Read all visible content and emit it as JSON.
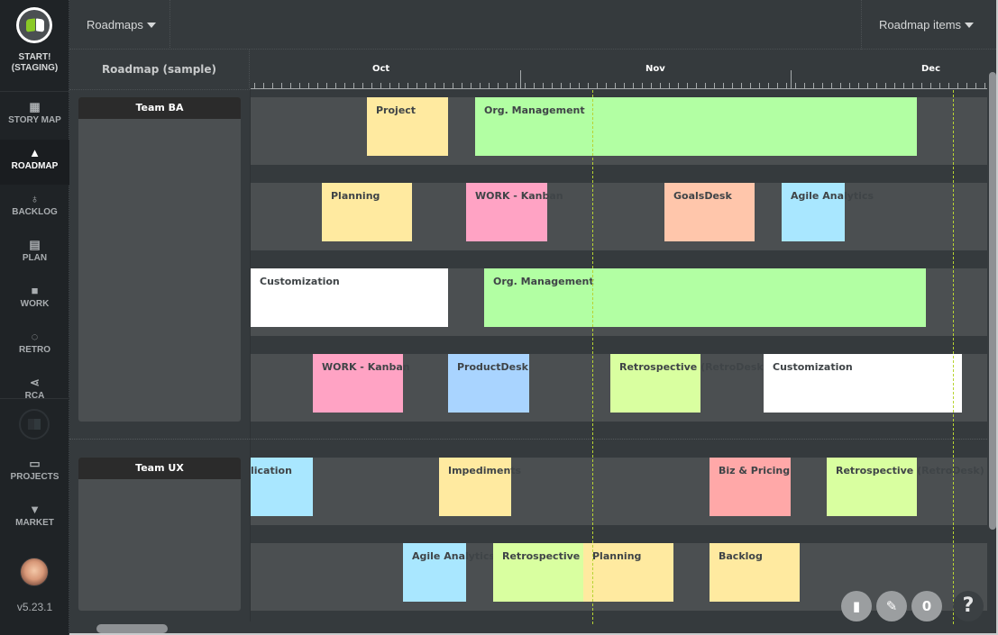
{
  "workspace": {
    "name_line1": "START!",
    "name_line2": "(STAGING)"
  },
  "nav": {
    "items": [
      {
        "label": "STORY MAP",
        "icon": "grid-icon"
      },
      {
        "label": "ROADMAP",
        "icon": "road-icon",
        "active": true
      },
      {
        "label": "BACKLOG",
        "icon": "lightbulb-icon"
      },
      {
        "label": "PLAN",
        "icon": "list-icon"
      },
      {
        "label": "WORK",
        "icon": "briefcase-icon"
      },
      {
        "label": "RETRO",
        "icon": "chat-icon"
      },
      {
        "label": "RCA",
        "icon": "share-icon"
      }
    ],
    "bottom_items": [
      {
        "label": "PROJECTS",
        "icon": "folder-icon"
      },
      {
        "label": "MARKET",
        "icon": "basket-icon"
      }
    ],
    "version": "v5.23.1"
  },
  "topbar": {
    "roadmaps_label": "Roadmaps",
    "roadmap_items_label": "Roadmap items"
  },
  "roadmap": {
    "title": "Roadmap (sample)",
    "months": [
      "Oct",
      "Nov",
      "Dec"
    ],
    "teams": [
      {
        "name": "Team BA",
        "rows": [
          [
            {
              "title": "Project",
              "color": "#ffeaa0"
            },
            {
              "title": "Org. Management",
              "color": "#b2ffa3"
            }
          ],
          [
            {
              "title": "Planning",
              "color": "#ffeaa0"
            },
            {
              "title": "WORK - Kanban",
              "color": "#ffa3c4"
            },
            {
              "title": "GoalsDesk",
              "color": "#ffc6ab"
            },
            {
              "title": "Agile Analytics",
              "color": "#a9e7ff"
            }
          ],
          [
            {
              "title": "Customization",
              "color": "#ffffff"
            },
            {
              "title": "Org. Management",
              "color": "#b2ffa3"
            }
          ],
          [
            {
              "title": "WORK - Kanban",
              "color": "#ffa3c4"
            },
            {
              "title": "ProductDesk",
              "color": "#a9d4ff"
            },
            {
              "title": "Retrospective (RetroDesk)",
              "color": "#d9ffa0"
            },
            {
              "title": "Customization",
              "color": "#ffffff"
            }
          ]
        ]
      },
      {
        "name": "Team UX",
        "rows": [
          [
            {
              "title": "lication",
              "color": "#a9e7ff"
            },
            {
              "title": "Impediments",
              "color": "#ffeaa0"
            },
            {
              "title": "Biz & Pricing",
              "color": "#ffa8a8"
            },
            {
              "title": "Retrospective (RetroDesk)",
              "color": "#d9ffa0"
            }
          ],
          [
            {
              "title": "Agile Analytics",
              "color": "#a9e7ff"
            },
            {
              "title": "Retrospective (R",
              "color": "#d9ffa0"
            },
            {
              "title": "Planning",
              "color": "#ffeaa0"
            },
            {
              "title": "Backlog",
              "color": "#ffeaa0"
            }
          ]
        ]
      }
    ]
  },
  "floating": {
    "notes_icon": "book-icon",
    "edit_icon": "pencil-icon",
    "count": "0",
    "help": "?"
  }
}
